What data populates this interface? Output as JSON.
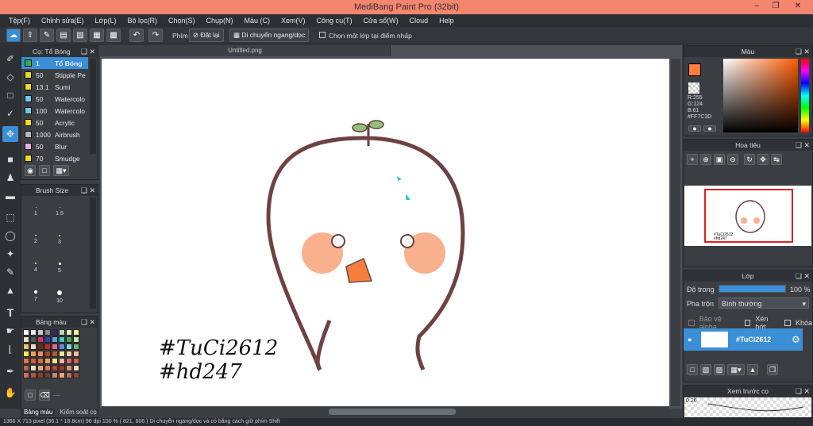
{
  "window": {
    "title": "MediBang Paint Pro (32bit)"
  },
  "menu": [
    "Tệp(F)",
    "Chỉnh sửa(E)",
    "Lớp(L)",
    "Bộ lọc(R)",
    "Chọn(S)",
    "Chụp(N)",
    "Màu (C)",
    "Xem(V)",
    "Công cụ(T)",
    "Cửa sổ(W)",
    "Cloud",
    "Help"
  ],
  "toolbar": {
    "pen_label": "Phím",
    "reset_label": "Đặt lại",
    "move_label": "Di chuyển ngang/dọc",
    "select_layer_label": "Chọn một lớp tại điểm nhấp"
  },
  "document": {
    "tab": "Untitled.png"
  },
  "brush_panel": {
    "title": "Cọ: Tổ Bóng",
    "items": [
      {
        "size": "1",
        "name": "Tổ Bóng",
        "color": "#2bb34a"
      },
      {
        "size": "50",
        "name": "Stipple Pe",
        "color": "#f2dd1c"
      },
      {
        "size": "13.1",
        "name": "Sumi",
        "color": "#f2dd1c"
      },
      {
        "size": "50",
        "name": "Watercolo",
        "color": "#6ecbf0"
      },
      {
        "size": "100",
        "name": "Watercolo",
        "color": "#6ecbf0"
      },
      {
        "size": "50",
        "name": "Acrylic",
        "color": "#f2dd1c"
      },
      {
        "size": "1000",
        "name": "Airbrush",
        "color": "#b8b8b8"
      },
      {
        "size": "50",
        "name": "Blur",
        "color": "#f0a8e8"
      },
      {
        "size": "70",
        "name": "Smudge",
        "color": "#f2dd1c"
      }
    ]
  },
  "brush_size": {
    "title": "Brush Size",
    "sizes": [
      "1",
      "1.5",
      "2",
      "3",
      "4",
      "5",
      "7",
      "10"
    ]
  },
  "swatch": {
    "title": "Bảng màu",
    "tab1": "Bảng màu",
    "tab2": "Kiểm soát cọ",
    "more": "---"
  },
  "color": {
    "title": "Màu",
    "r": "R:255",
    "g": "G:124",
    "b": "B:61",
    "hex": "#FF7C3D"
  },
  "navigator": {
    "title": "Hoa tiêu",
    "thumb_text": "#TuCi2612 #hd247"
  },
  "layer": {
    "title": "Lớp",
    "opacity_label": "Độ trong",
    "opacity_value": "100 %",
    "opacity": 1.0,
    "blend_label": "Pha trộn",
    "blend_value": "Bình thường",
    "protect_alpha": "Bảo vệ alpha",
    "clipping": "Xén bớt",
    "lock": "Khóa",
    "layer_name": "#TuCi2612"
  },
  "preview": {
    "title": "Xem trước cọ",
    "size": "0.26"
  },
  "canvas": {
    "text1": "#TuCi2612",
    "text2": "#hd247"
  },
  "status": {
    "text": "1366 X 713 pixel  (36.1 * 18.8cm)  96 dpi  100 %  ( 821, 606 )  Di chuyển ngang/dọc và có bằng cách giữ phím Shift"
  },
  "colors": {
    "accent": "#3a8fd6",
    "fg_color": "#ff7c3d",
    "title_bar": "#f4856f"
  }
}
